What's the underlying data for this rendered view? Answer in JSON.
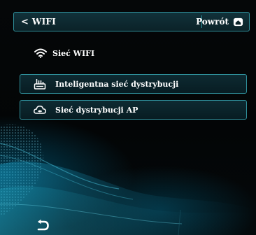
{
  "header": {
    "title": "WIFI",
    "back_icon": "chevron-left-icon",
    "return_label": "Powrót",
    "return_icon": "home-icon"
  },
  "wifi_section": {
    "label": "Sieć WIFI",
    "icon": "wifi-icon"
  },
  "options": [
    {
      "label": "Inteligentna sieć dystrybucji",
      "icon": "router-icon"
    },
    {
      "label": "Sieć dystrybucji AP",
      "icon": "cloud-icon"
    }
  ],
  "footer": {
    "back_icon": "return-arrow-icon"
  },
  "colors": {
    "accent": "#2f8f9a",
    "panel": "#0b2228",
    "background": "#04070a",
    "text": "#ffffff"
  }
}
